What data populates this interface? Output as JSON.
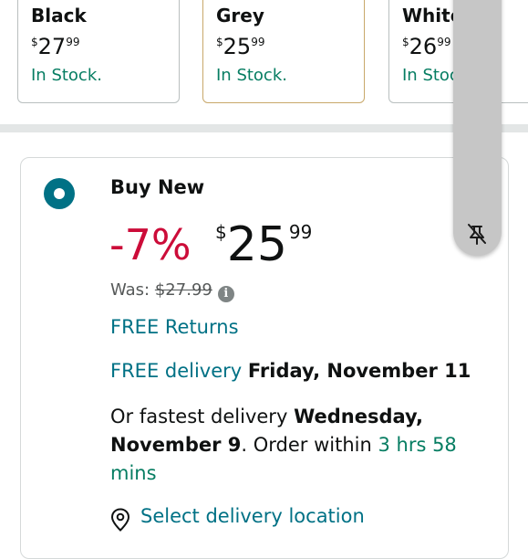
{
  "swatches": [
    {
      "name": "Black",
      "price_symbol": "$",
      "price_whole": "27",
      "price_fraction": "99",
      "stock": "In Stock."
    },
    {
      "name": "Grey",
      "price_symbol": "$",
      "price_whole": "25",
      "price_fraction": "99",
      "stock": "In Stock."
    },
    {
      "name": "White",
      "price_symbol": "$",
      "price_whole": "26",
      "price_fraction": "99",
      "stock": "In Stock."
    }
  ],
  "offer": {
    "title": "Buy New",
    "discount": "-7%",
    "price_symbol": "$",
    "price_whole": "25",
    "price_fraction": "99",
    "was_label": "Was:",
    "was_price": "$27.99",
    "info_icon": "info-icon",
    "free_returns": "FREE Returns",
    "delivery_link": "FREE delivery",
    "delivery_date": "Friday, November 11",
    "fastest_prefix": "Or fastest delivery",
    "fastest_date": "Wednesday, November 9",
    "fastest_middle": ". Order within",
    "fastest_time": "3 hrs 58 mins",
    "location_icon": "location-pin-icon",
    "location_text": "Select delivery location"
  },
  "scroll_handle": {
    "icon": "no-drag-icon"
  },
  "colors": {
    "link": "#007185",
    "stock_green": "#067d62",
    "discount_red": "#cc0c39",
    "selected_border": "#c8a86a",
    "divider": "#e3e6e6"
  }
}
